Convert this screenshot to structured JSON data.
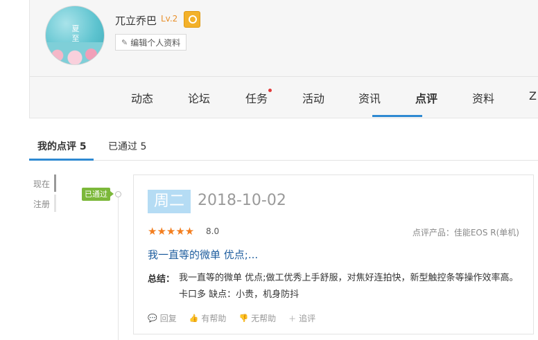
{
  "profile": {
    "username": "兀立乔巴",
    "level": "Lv.2",
    "edit_label": "编辑个人资料",
    "avatar_text": "夏至"
  },
  "nav": {
    "tabs": [
      "动态",
      "论坛",
      "任务",
      "活动",
      "资讯",
      "点评",
      "资料",
      "Z"
    ],
    "active": "点评"
  },
  "sub_tabs": {
    "mine": "我的点评 5",
    "passed": "已通过 5"
  },
  "timeline": {
    "now": "现在",
    "register": "注册",
    "status": "已通过"
  },
  "review": {
    "weekday": "周二",
    "date": "2018-10-02",
    "stars": "★★★★★",
    "rating": "8.0",
    "product": "点评产品：佳能EOS R(单机)",
    "headline": "我一直等的微单 优点;...",
    "summary_label": "总结：",
    "summary": "我一直等的微单 优点;做工优秀上手舒服，对焦好连拍快，新型触控条等操作效率高。卡口多 缺点：小贵，机身防抖",
    "actions": {
      "reply": "回复",
      "helpful": "有帮助",
      "not_helpful": "无帮助",
      "followup": "追评"
    }
  },
  "colors": {
    "accent": "#2e89d2",
    "badge_green": "#7cb83a",
    "star_orange": "#f37e1f",
    "level_orange": "#e8902c",
    "day_box": "#b5dcf4"
  }
}
